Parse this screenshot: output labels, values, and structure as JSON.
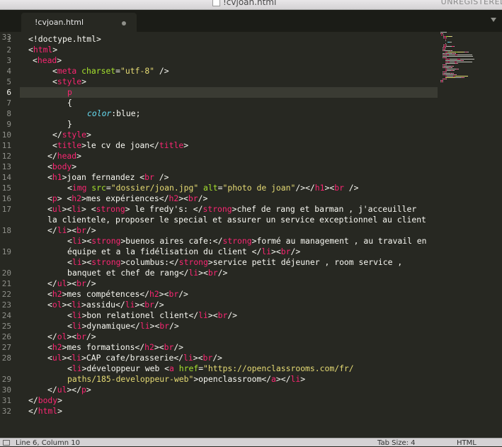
{
  "window": {
    "title": "!cvjoan.html",
    "unregistered": "UNREGISTERED"
  },
  "tab": {
    "label": "!cvjoan.html"
  },
  "status": {
    "position": "Line 6, Column 10",
    "tab_size": "Tab Size: 4",
    "syntax": "HTML"
  },
  "theme": {
    "background": "#272822",
    "tag": "#f92672",
    "attribute": "#a6e22e",
    "string": "#e6db74",
    "property": "#66d9ef",
    "text": "#f8f8f2",
    "gutter": "#8f908a"
  },
  "current_line": 6,
  "line_numbers": [
    "1",
    "2",
    "3",
    "4",
    "5",
    "6",
    "7",
    "8",
    "9",
    "10",
    "11",
    "12",
    "13",
    "14",
    "15",
    "16",
    "17",
    "18",
    "19",
    "20",
    "21",
    "22",
    "23",
    "24",
    "25",
    "26",
    "27",
    "28",
    "29",
    "30",
    "31",
    "32",
    "33"
  ],
  "code_lines": [
    [
      [
        "t",
        "!doctype.html"
      ],
      [
        "",
        "&gt;"
      ]
    ],
    [
      [
        "",
        "&lt;"
      ],
      [
        "t",
        "html"
      ],
      [
        "",
        "&gt;"
      ]
    ],
    [
      [
        "",
        ""
      ]
    ],
    [
      [
        "",
        "&lt;"
      ],
      [
        "t",
        "meta "
      ],
      [
        "a",
        "charset"
      ],
      [
        "",
        "="
      ],
      [
        "s",
        "\"utf-8\""
      ],
      [
        "",
        " /&gt;"
      ]
    ],
    [
      [
        "",
        "&lt;"
      ],
      [
        "t",
        "style"
      ],
      [
        "",
        "&gt;"
      ]
    ],
    [
      [
        "t",
        "p"
      ]
    ],
    [
      [
        "",
        "{"
      ]
    ],
    [
      [
        "p",
        "color"
      ],
      [
        "",
        ":blue;"
      ]
    ],
    [
      [
        "",
        "}"
      ]
    ],
    [
      [
        "",
        "&lt;/"
      ],
      [
        "t",
        "style"
      ],
      [
        "",
        "&gt;"
      ]
    ],
    [
      [
        "",
        "&lt;"
      ],
      [
        "t",
        "title"
      ],
      [
        "",
        "&gt;le cv de joan&lt;/"
      ],
      [
        "t",
        "title"
      ],
      [
        "",
        "&gt;"
      ]
    ],
    [
      [
        "",
        "&lt;/"
      ],
      [
        "t",
        "head"
      ],
      [
        "",
        "&gt;"
      ]
    ],
    [
      [
        "",
        "&lt;"
      ],
      [
        "t",
        "body"
      ],
      [
        "",
        "&gt;"
      ]
    ],
    [
      [
        "",
        "&lt;"
      ],
      [
        "t",
        "h1"
      ],
      [
        "",
        "&gt;joan fernandez &lt;"
      ],
      [
        "t",
        "br"
      ],
      [
        "",
        " /&gt;"
      ]
    ],
    [
      [
        "",
        "&lt;"
      ],
      [
        "t",
        "img "
      ],
      [
        "a",
        "src"
      ],
      [
        "",
        "="
      ],
      [
        "s",
        "\"dossier/joan.jpg\""
      ],
      [
        "",
        " "
      ],
      [
        "a",
        "alt"
      ],
      [
        "",
        "="
      ],
      [
        "s",
        "\"photo de joan\""
      ],
      [
        "",
        "/&gt;&lt;/"
      ],
      [
        "t",
        "h1"
      ],
      [
        "",
        "&gt;&lt;"
      ],
      [
        "t",
        "br"
      ],
      [
        "",
        " /&gt;"
      ]
    ],
    [
      [
        "",
        "&lt;"
      ],
      [
        "t",
        "p"
      ],
      [
        "",
        "&gt; &lt;"
      ],
      [
        "t",
        "h2"
      ],
      [
        "",
        "&gt;mes expériences&lt;/"
      ],
      [
        "t",
        "h2"
      ],
      [
        "",
        "&gt;&lt;"
      ],
      [
        "t",
        "br"
      ],
      [
        "",
        "/&gt;"
      ]
    ],
    [
      [
        "",
        "&lt;"
      ],
      [
        "t",
        "ul"
      ],
      [
        "",
        "&gt;&lt;"
      ],
      [
        "t",
        "li"
      ],
      [
        "",
        "&gt; &lt;"
      ],
      [
        "t",
        "strong"
      ],
      [
        "",
        "&gt; le fredy's: &lt;/"
      ],
      [
        "t",
        "strong"
      ],
      [
        "",
        "&gt;chef de rang et barman , j'acceuiller"
      ]
    ],
    [
      [
        "",
        "la clientele, proposer le special et assurer un service exceptionnel au client"
      ]
    ],
    [
      [
        "",
        "&lt;/"
      ],
      [
        "t",
        "li"
      ],
      [
        "",
        "&gt;&lt;"
      ],
      [
        "t",
        "br"
      ],
      [
        "",
        "/&gt;"
      ]
    ],
    [
      [
        "",
        "&lt;"
      ],
      [
        "t",
        "li"
      ],
      [
        "",
        "&gt;&lt;"
      ],
      [
        "t",
        "strong"
      ],
      [
        "",
        "&gt;buenos aires cafe:&lt;/"
      ],
      [
        "t",
        "strong"
      ],
      [
        "",
        "&gt;formé au management , au travail en"
      ]
    ],
    [
      [
        "",
        "équipe et a la fidélisation du client &lt;/"
      ],
      [
        "t",
        "li"
      ],
      [
        "",
        "&gt;&lt;"
      ],
      [
        "t",
        "br"
      ],
      [
        "",
        "/&gt;"
      ]
    ],
    [
      [
        "",
        "&lt;"
      ],
      [
        "t",
        "li"
      ],
      [
        "",
        "&gt;&lt;"
      ],
      [
        "t",
        "strong"
      ],
      [
        "",
        "&gt;columbus:&lt;/"
      ],
      [
        "t",
        "strong"
      ],
      [
        "",
        "&gt;service petit déjeuner , room service ,"
      ]
    ],
    [
      [
        "",
        "banquet et chef de rang&lt;/"
      ],
      [
        "t",
        "li"
      ],
      [
        "",
        "&gt;&lt;"
      ],
      [
        "t",
        "br"
      ],
      [
        "",
        "/&gt;"
      ]
    ],
    [
      [
        "",
        "&lt;/"
      ],
      [
        "t",
        "ul"
      ],
      [
        "",
        "&gt;&lt;"
      ],
      [
        "t",
        "br"
      ],
      [
        "",
        "/&gt;"
      ]
    ],
    [
      [
        "",
        "&lt;"
      ],
      [
        "t",
        "h2"
      ],
      [
        "",
        "&gt;mes compétences&lt;/"
      ],
      [
        "t",
        "h2"
      ],
      [
        "",
        "&gt;&lt;"
      ],
      [
        "t",
        "br"
      ],
      [
        "",
        "/&gt;"
      ]
    ],
    [
      [
        "",
        "&lt;"
      ],
      [
        "t",
        "ol"
      ],
      [
        "",
        "&gt;&lt;"
      ],
      [
        "t",
        "li"
      ],
      [
        "",
        "&gt;assidu&lt;/"
      ],
      [
        "t",
        "li"
      ],
      [
        "",
        "&gt;&lt;"
      ],
      [
        "t",
        "br"
      ],
      [
        "",
        "/&gt;"
      ]
    ],
    [
      [
        "",
        "&lt;"
      ],
      [
        "t",
        "li"
      ],
      [
        "",
        "&gt;bon relationel client&lt;/"
      ],
      [
        "t",
        "li"
      ],
      [
        "",
        "&gt;&lt;"
      ],
      [
        "t",
        "br"
      ],
      [
        "",
        "/&gt;"
      ]
    ],
    [
      [
        "",
        "&lt;"
      ],
      [
        "t",
        "li"
      ],
      [
        "",
        "&gt;dynamique&lt;/"
      ],
      [
        "t",
        "li"
      ],
      [
        "",
        "&gt;&lt;"
      ],
      [
        "t",
        "br"
      ],
      [
        "",
        "/&gt;"
      ]
    ],
    [
      [
        "",
        "&lt;/"
      ],
      [
        "t",
        "ol"
      ],
      [
        "",
        "&gt;&lt;"
      ],
      [
        "t",
        "br"
      ],
      [
        "",
        "/&gt;"
      ]
    ],
    [
      [
        "",
        "&lt;"
      ],
      [
        "t",
        "h2"
      ],
      [
        "",
        "&gt;mes formations&lt;/"
      ],
      [
        "t",
        "h2"
      ],
      [
        "",
        "&gt;&lt;"
      ],
      [
        "t",
        "br"
      ],
      [
        "",
        "/&gt;"
      ]
    ],
    [
      [
        "",
        "&lt;"
      ],
      [
        "t",
        "ul"
      ],
      [
        "",
        "&gt;&lt;"
      ],
      [
        "t",
        "li"
      ],
      [
        "",
        "&gt;CAP cafe/brasserie&lt;/"
      ],
      [
        "t",
        "li"
      ],
      [
        "",
        "&gt;&lt;"
      ],
      [
        "t",
        "br"
      ],
      [
        "",
        "/&gt;"
      ]
    ],
    [
      [
        "",
        "&lt;"
      ],
      [
        "t",
        "li"
      ],
      [
        "",
        "&gt;développeur web &lt;"
      ],
      [
        "t",
        "a "
      ],
      [
        "a",
        "href"
      ],
      [
        "",
        "="
      ],
      [
        "s",
        "\"https://openclassrooms.com/fr/"
      ]
    ],
    [
      [
        "s",
        "paths/185-developpeur-web\""
      ],
      [
        "",
        "&gt;openclassroom&lt;/"
      ],
      [
        "t",
        "a"
      ],
      [
        "",
        "&gt;&lt;/"
      ],
      [
        "t",
        "li"
      ],
      [
        "",
        "&gt;"
      ]
    ],
    [
      [
        "",
        "&lt;/"
      ],
      [
        "t",
        "ul"
      ],
      [
        "",
        "&gt;&lt;/"
      ],
      [
        "t",
        "p"
      ],
      [
        "",
        "&gt;"
      ]
    ],
    [
      [
        "",
        "&lt;/"
      ],
      [
        "t",
        "body"
      ],
      [
        "",
        "&gt;"
      ]
    ],
    [
      [
        "",
        "&lt;/"
      ],
      [
        "t",
        "html"
      ],
      [
        "",
        "&gt;"
      ]
    ]
  ]
}
